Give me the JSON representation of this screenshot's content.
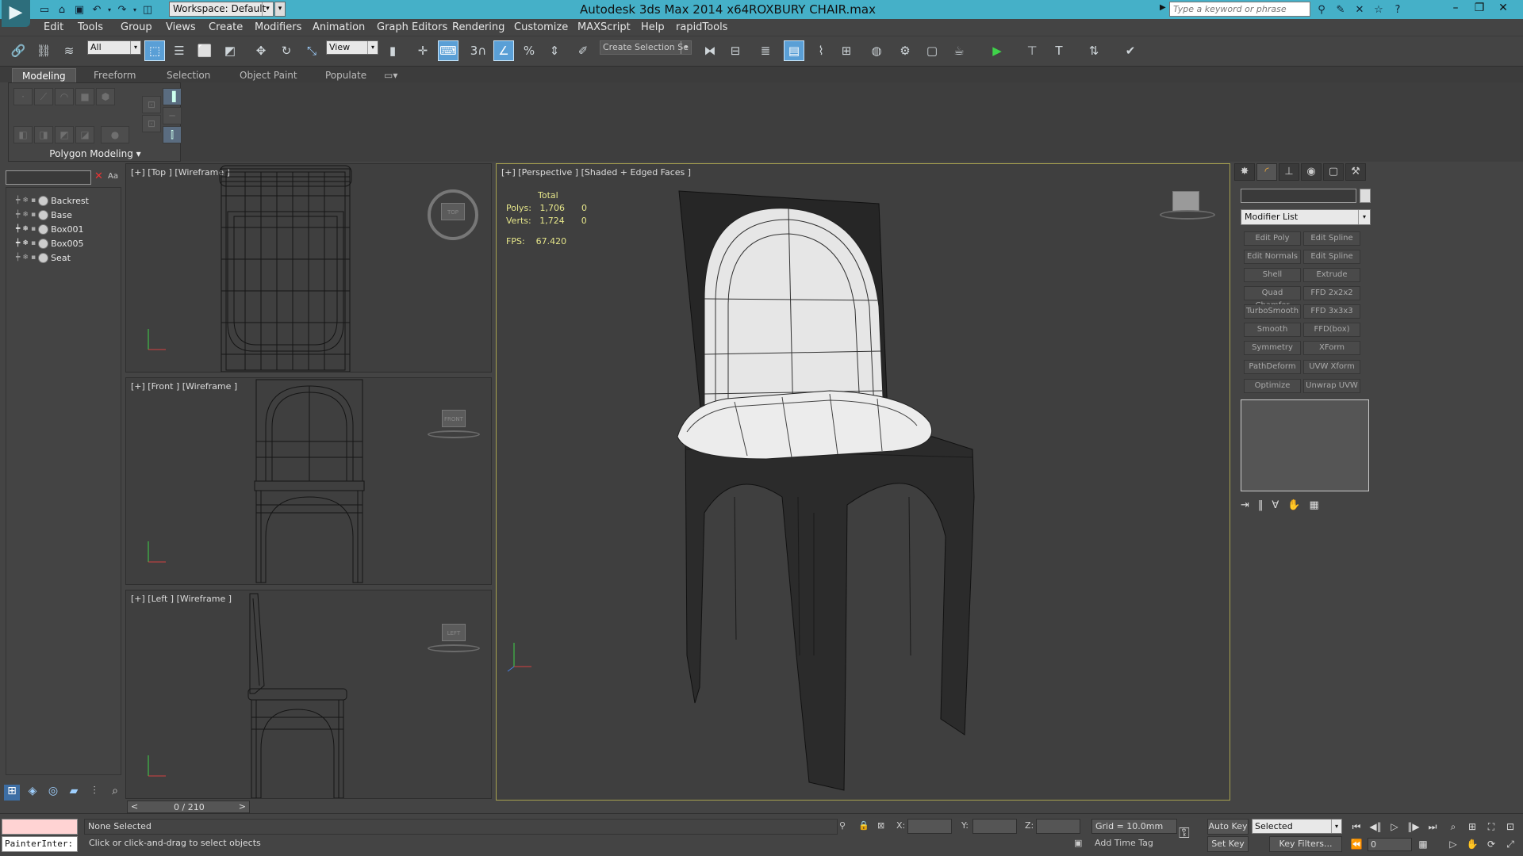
{
  "window": {
    "app_title": "Autodesk 3ds Max  2014 x64",
    "file_title": "ROXBURY CHAIR.max",
    "workspace_label": "Workspace: Default",
    "search_placeholder": "Type a keyword or phrase"
  },
  "menu": [
    "Edit",
    "Tools",
    "Group",
    "Views",
    "Create",
    "Modifiers",
    "Animation",
    "Graph Editors",
    "Rendering",
    "Customize",
    "MAXScript",
    "Help",
    "rapidTools"
  ],
  "toolbar": {
    "selection_filter": "All",
    "ref_coord": "View",
    "named_selection": "Create Selection Se",
    "snap_3": "3"
  },
  "ribbon": {
    "tabs": [
      "Modeling",
      "Freeform",
      "Selection",
      "Object Paint",
      "Populate"
    ],
    "panel_label": "Polygon Modeling"
  },
  "scene_explorer": {
    "search_value": "",
    "items": [
      "Backrest",
      "Base",
      "Box001",
      "Box005",
      "Seat"
    ]
  },
  "viewports": {
    "top": "[+] [Top ] [Wireframe ]",
    "front": "[+] [Front ] [Wireframe ]",
    "left": "[+] [Left ] [Wireframe ]",
    "perspective": "[+] [Perspective ] [Shaded + Edged Faces ]",
    "cube_top": "TOP",
    "cube_front": "FRONT",
    "cube_left": "LEFT"
  },
  "stats": {
    "header": "Total",
    "polys_label": "Polys:",
    "polys_total": "1,706",
    "polys_sel": "0",
    "verts_label": "Verts:",
    "verts_total": "1,724",
    "verts_sel": "0",
    "fps_label": "FPS:",
    "fps_value": "67.420"
  },
  "command_panel": {
    "modifier_list": "Modifier List",
    "modifier_buttons": [
      "Edit Poly",
      "Edit Spline",
      "Edit Normals",
      "Edit Spline",
      "Shell",
      "Extrude",
      "Quad Chamfer",
      "FFD 2x2x2",
      "TurboSmooth",
      "FFD 3x3x3",
      "Smooth",
      "FFD(box)",
      "Symmetry",
      "XForm",
      "PathDeform",
      "UVW Xform",
      "Optimize",
      "Unwrap UVW"
    ]
  },
  "timeline": {
    "position": "0 / 210"
  },
  "status": {
    "listener": "PainterInter:",
    "selection": "None Selected",
    "prompt": "Click or click-and-drag to select objects",
    "x_label": "X:",
    "y_label": "Y:",
    "z_label": "Z:",
    "grid": "Grid = 10.0mm",
    "add_time_tag": "Add Time Tag",
    "auto_key": "Auto Key",
    "set_key": "Set Key",
    "selected_dropdown": "Selected",
    "key_filters": "Key Filters...",
    "frame": "0"
  },
  "colors": {
    "titlebar": "#45b0c8",
    "active_viewport_border": "#a7a14f",
    "stats_text": "#e6e68a"
  }
}
